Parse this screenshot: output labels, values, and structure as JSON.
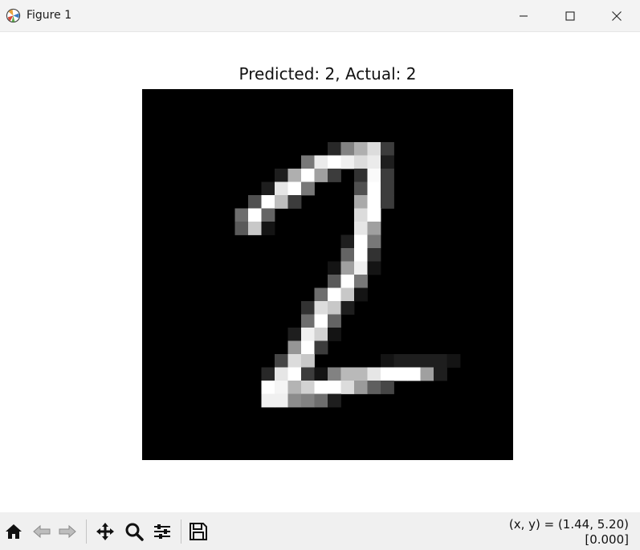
{
  "window": {
    "title": "Figure 1",
    "icon": "matplotlib-logo-icon",
    "controls": [
      "minimize-icon",
      "maximize-icon",
      "close-icon"
    ]
  },
  "figure": {
    "title": "Predicted: 2, Actual: 2",
    "colormap": "gray",
    "image_size": [
      28,
      28
    ],
    "axes_visible": false
  },
  "toolbar": {
    "buttons": [
      "home-icon",
      "back-icon",
      "forward-icon",
      "pan-icon",
      "zoom-icon",
      "configure-subplots-icon",
      "save-icon"
    ],
    "coords_line1": "(x, y) = (1.44, 5.20)",
    "coords_line2": "[0.000]"
  },
  "chart_data": {
    "type": "heatmap",
    "title": "Predicted: 2, Actual: 2",
    "colormap": "gray",
    "width": 28,
    "height": 28,
    "pixel_rows": [
      [
        4,
        [
          0,
          0,
          0,
          0,
          0,
          0,
          0,
          0,
          0,
          0,
          0,
          0,
          0,
          0,
          40,
          130,
          175,
          220,
          60,
          0,
          0,
          0,
          0,
          0,
          0,
          0,
          0,
          0
        ]
      ],
      [
        5,
        [
          0,
          0,
          0,
          0,
          0,
          0,
          0,
          0,
          0,
          0,
          0,
          0,
          120,
          235,
          255,
          240,
          220,
          235,
          30,
          0,
          0,
          0,
          0,
          0,
          0,
          0,
          0,
          0
        ]
      ],
      [
        6,
        [
          0,
          0,
          0,
          0,
          0,
          0,
          0,
          0,
          0,
          0,
          30,
          175,
          255,
          160,
          60,
          0,
          50,
          250,
          60,
          0,
          0,
          0,
          0,
          0,
          0,
          0,
          0,
          0
        ]
      ],
      [
        7,
        [
          0,
          0,
          0,
          0,
          0,
          0,
          0,
          0,
          0,
          30,
          230,
          255,
          120,
          0,
          0,
          0,
          80,
          255,
          60,
          0,
          0,
          0,
          0,
          0,
          0,
          0,
          0,
          0
        ]
      ],
      [
        8,
        [
          0,
          0,
          0,
          0,
          0,
          0,
          0,
          0,
          80,
          255,
          190,
          60,
          0,
          0,
          0,
          0,
          170,
          255,
          60,
          0,
          0,
          0,
          0,
          0,
          0,
          0,
          0,
          0
        ]
      ],
      [
        9,
        [
          0,
          0,
          0,
          0,
          0,
          0,
          0,
          110,
          255,
          100,
          0,
          0,
          0,
          0,
          0,
          0,
          220,
          255,
          0,
          0,
          0,
          0,
          0,
          0,
          0,
          0,
          0,
          0
        ]
      ],
      [
        10,
        [
          0,
          0,
          0,
          0,
          0,
          0,
          0,
          90,
          200,
          20,
          0,
          0,
          0,
          0,
          0,
          0,
          230,
          160,
          0,
          0,
          0,
          0,
          0,
          0,
          0,
          0,
          0,
          0
        ]
      ],
      [
        11,
        [
          0,
          0,
          0,
          0,
          0,
          0,
          0,
          0,
          0,
          0,
          0,
          0,
          0,
          0,
          0,
          30,
          255,
          120,
          0,
          0,
          0,
          0,
          0,
          0,
          0,
          0,
          0,
          0
        ]
      ],
      [
        12,
        [
          0,
          0,
          0,
          0,
          0,
          0,
          0,
          0,
          0,
          0,
          0,
          0,
          0,
          0,
          0,
          100,
          255,
          50,
          0,
          0,
          0,
          0,
          0,
          0,
          0,
          0,
          0,
          0
        ]
      ],
      [
        13,
        [
          0,
          0,
          0,
          0,
          0,
          0,
          0,
          0,
          0,
          0,
          0,
          0,
          0,
          0,
          20,
          160,
          240,
          20,
          0,
          0,
          0,
          0,
          0,
          0,
          0,
          0,
          0,
          0
        ]
      ],
      [
        14,
        [
          0,
          0,
          0,
          0,
          0,
          0,
          0,
          0,
          0,
          0,
          0,
          0,
          0,
          0,
          90,
          255,
          120,
          0,
          0,
          0,
          0,
          0,
          0,
          0,
          0,
          0,
          0,
          0
        ]
      ],
      [
        15,
        [
          0,
          0,
          0,
          0,
          0,
          0,
          0,
          0,
          0,
          0,
          0,
          0,
          0,
          110,
          255,
          200,
          20,
          0,
          0,
          0,
          0,
          0,
          0,
          0,
          0,
          0,
          0,
          0
        ]
      ],
      [
        16,
        [
          0,
          0,
          0,
          0,
          0,
          0,
          0,
          0,
          0,
          0,
          0,
          0,
          50,
          220,
          200,
          30,
          0,
          0,
          0,
          0,
          0,
          0,
          0,
          0,
          0,
          0,
          0,
          0
        ]
      ],
      [
        17,
        [
          0,
          0,
          0,
          0,
          0,
          0,
          0,
          0,
          0,
          0,
          0,
          0,
          110,
          255,
          100,
          0,
          0,
          0,
          0,
          0,
          0,
          0,
          0,
          0,
          0,
          0,
          0,
          0
        ]
      ],
      [
        18,
        [
          0,
          0,
          0,
          0,
          0,
          0,
          0,
          0,
          0,
          0,
          0,
          30,
          240,
          210,
          20,
          0,
          0,
          0,
          0,
          0,
          0,
          0,
          0,
          0,
          0,
          0,
          0,
          0
        ]
      ],
      [
        19,
        [
          0,
          0,
          0,
          0,
          0,
          0,
          0,
          0,
          0,
          0,
          0,
          150,
          255,
          60,
          0,
          0,
          0,
          0,
          0,
          0,
          0,
          0,
          0,
          0,
          0,
          0,
          0,
          0
        ]
      ],
      [
        20,
        [
          0,
          0,
          0,
          0,
          0,
          0,
          0,
          0,
          0,
          0,
          70,
          220,
          200,
          0,
          0,
          0,
          0,
          0,
          20,
          30,
          30,
          30,
          30,
          20,
          0,
          0,
          0,
          0
        ]
      ],
      [
        21,
        [
          0,
          0,
          0,
          0,
          0,
          0,
          0,
          0,
          0,
          40,
          230,
          255,
          60,
          20,
          130,
          185,
          185,
          230,
          255,
          255,
          255,
          160,
          30,
          0,
          0,
          0,
          0,
          0
        ]
      ],
      [
        22,
        [
          0,
          0,
          0,
          0,
          0,
          0,
          0,
          0,
          0,
          255,
          245,
          180,
          210,
          255,
          255,
          220,
          155,
          95,
          70,
          0,
          0,
          0,
          0,
          0,
          0,
          0,
          0,
          0
        ]
      ],
      [
        23,
        [
          0,
          0,
          0,
          0,
          0,
          0,
          0,
          0,
          0,
          240,
          240,
          140,
          130,
          110,
          30,
          0,
          0,
          0,
          0,
          0,
          0,
          0,
          0,
          0,
          0,
          0,
          0,
          0
        ]
      ]
    ],
    "display_range": [
      0,
      255
    ]
  }
}
